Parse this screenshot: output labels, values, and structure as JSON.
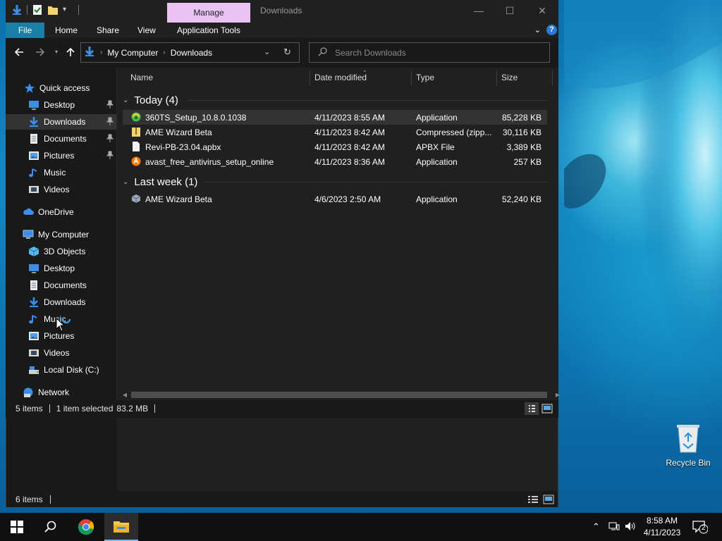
{
  "window": {
    "title": "Downloads",
    "manage_tab": "Manage",
    "minimize": "—",
    "maximize": "☐",
    "close": "✕"
  },
  "ribbon": {
    "tabs": [
      "File",
      "Home",
      "Share",
      "View",
      "Application Tools"
    ],
    "help": "?"
  },
  "address": {
    "crumbs": [
      "My Computer",
      "Downloads"
    ]
  },
  "search": {
    "placeholder": "Search Downloads"
  },
  "sidebar": {
    "items": [
      {
        "label": "Quick access",
        "icon": "star-icon"
      },
      {
        "label": "Desktop",
        "icon": "desktop-icon",
        "pinned": true
      },
      {
        "label": "Downloads",
        "icon": "download-icon",
        "pinned": true,
        "selected": true
      },
      {
        "label": "Documents",
        "icon": "documents-icon",
        "pinned": true
      },
      {
        "label": "Pictures",
        "icon": "pictures-icon",
        "pinned": true
      },
      {
        "label": "Music",
        "icon": "music-icon"
      },
      {
        "label": "Videos",
        "icon": "videos-icon"
      },
      {
        "label": "OneDrive",
        "icon": "cloud-icon"
      },
      {
        "label": "My Computer",
        "icon": "computer-icon"
      },
      {
        "label": "3D Objects",
        "icon": "cube-icon"
      },
      {
        "label": "Desktop",
        "icon": "desktop-icon"
      },
      {
        "label": "Documents",
        "icon": "documents-icon"
      },
      {
        "label": "Downloads",
        "icon": "download-icon"
      },
      {
        "label": "Music",
        "icon": "music-icon"
      },
      {
        "label": "Pictures",
        "icon": "pictures-icon"
      },
      {
        "label": "Videos",
        "icon": "videos-icon"
      },
      {
        "label": "Local Disk (C:)",
        "icon": "drive-icon"
      },
      {
        "label": "Network",
        "icon": "network-icon"
      }
    ]
  },
  "columns": [
    "Name",
    "Date modified",
    "Type",
    "Size"
  ],
  "groups": [
    {
      "title": "Today (4)",
      "files": [
        {
          "name": "360TS_Setup_10.8.0.1038",
          "date": "4/11/2023 8:55 AM",
          "type": "Application",
          "size": "85,228 KB",
          "icon": "installer-360-icon",
          "selected": true
        },
        {
          "name": "AME Wizard Beta",
          "date": "4/11/2023 8:42 AM",
          "type": "Compressed (zipp...",
          "size": "30,116 KB",
          "icon": "zip-folder-icon"
        },
        {
          "name": "Revi-PB-23.04.apbx",
          "date": "4/11/2023 8:42 AM",
          "type": "APBX File",
          "size": "3,389 KB",
          "icon": "blank-file-icon"
        },
        {
          "name": "avast_free_antivirus_setup_online",
          "date": "4/11/2023 8:36 AM",
          "type": "Application",
          "size": "257 KB",
          "icon": "avast-icon"
        }
      ]
    },
    {
      "title": "Last week (1)",
      "files": [
        {
          "name": "AME Wizard Beta",
          "date": "4/6/2023 2:50 AM",
          "type": "Application",
          "size": "52,240 KB",
          "icon": "app-cube-icon"
        }
      ]
    }
  ],
  "status": {
    "items": "5 items",
    "selected": "1 item selected",
    "size": "83.2 MB"
  },
  "back_status": {
    "items": "6 items"
  },
  "desktop": {
    "recycle_bin": "Recycle Bin"
  },
  "taskbar": {
    "time": "8:58 AM",
    "date": "4/11/2023",
    "notifications": "2"
  },
  "colors": {
    "accent": "#1a7fa6",
    "manage_tab": "#e9c4f3",
    "selection": "#333333"
  }
}
